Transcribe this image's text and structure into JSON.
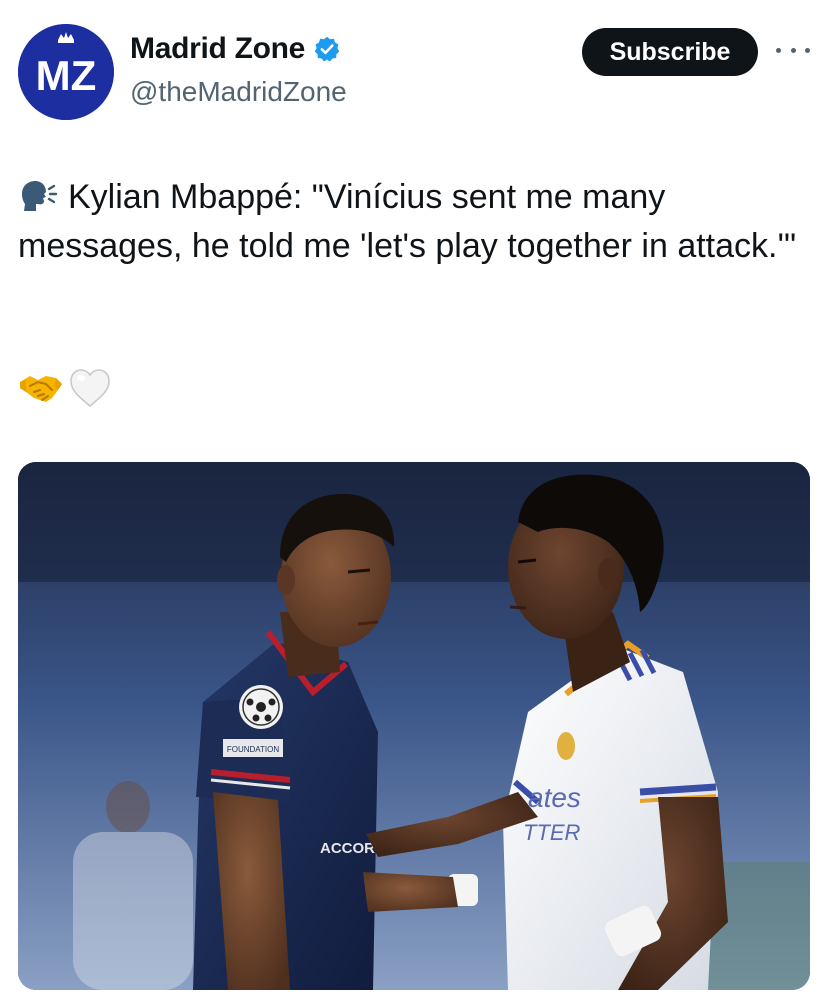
{
  "account": {
    "display_name": "Madrid Zone",
    "handle": "@theMadridZone",
    "avatar_text": "MZ",
    "verified_icon": "verified-badge-icon",
    "avatar_color": "#1d2ea0"
  },
  "actions": {
    "subscribe_label": "Subscribe",
    "more_icon": "more-options-icon"
  },
  "tweet": {
    "speaker_icon": "speaking-head-icon",
    "text": "Kylian Mbappé: \"Vinícius sent me many messages, he told me 'let's play together in attack.'\"",
    "emojis": [
      "handshake-icon",
      "white-heart-icon"
    ]
  },
  "media": {
    "kit_badge_text": "FOUNDATION",
    "sponsor_text": "ACCOR",
    "jersey_text_1": "ates",
    "jersey_text_2": "TTER"
  },
  "colors": {
    "verified_blue": "#1d9bf0",
    "text_primary": "#0f1419",
    "text_secondary": "#536471",
    "button_dark": "#0f1419"
  }
}
